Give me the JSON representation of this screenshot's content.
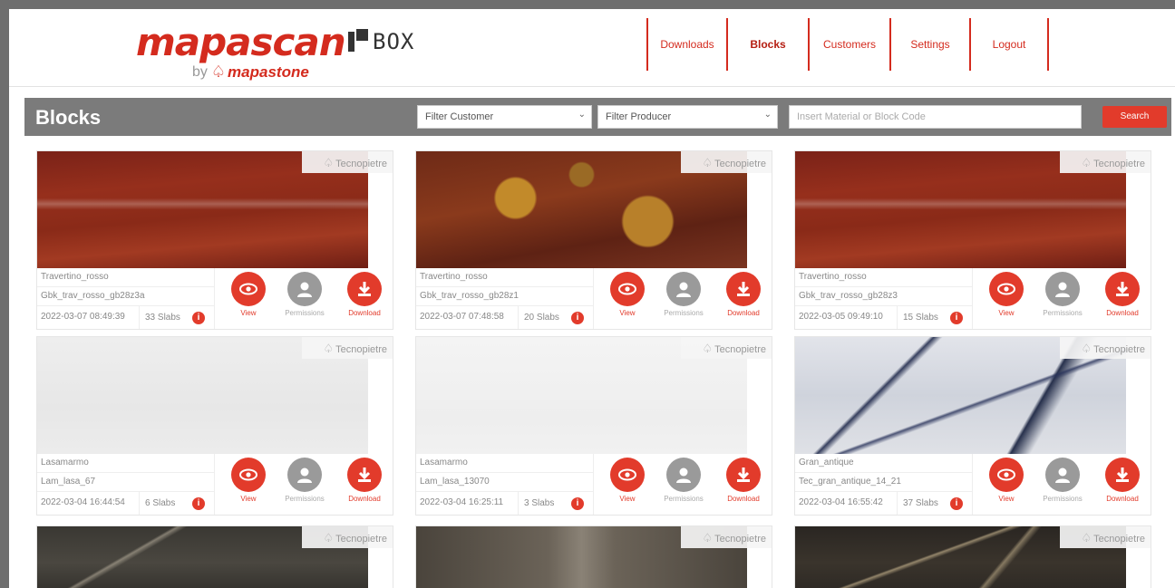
{
  "app": {
    "logo_main": "mapascan",
    "logo_box": "BOX",
    "logo_by": "by",
    "logo_brand": "mapastone"
  },
  "nav": {
    "items": [
      {
        "label": "Downloads"
      },
      {
        "label": "Blocks"
      },
      {
        "label": "Customers"
      },
      {
        "label": "Settings"
      },
      {
        "label": "Logout"
      }
    ]
  },
  "toolbar": {
    "title": "Blocks",
    "filter_customer": "Filter Customer",
    "filter_producer": "Filter Producer",
    "search_placeholder": "Insert Material or Block Code",
    "search_label": "Search"
  },
  "card_labels": {
    "brand": "Tecnopietre",
    "view": "View",
    "permissions": "Permissions",
    "download": "Download"
  },
  "blocks": [
    {
      "material": "Travertino_rosso",
      "code": "Gbk_trav_rosso_gb28z3a",
      "date": "2022-03-07 08:49:39",
      "slabs": "33 Slabs"
    },
    {
      "material": "Travertino_rosso",
      "code": "Gbk_trav_rosso_gb28z1",
      "date": "2022-03-07 07:48:58",
      "slabs": "20 Slabs"
    },
    {
      "material": "Travertino_rosso",
      "code": "Gbk_trav_rosso_gb28z3",
      "date": "2022-03-05 09:49:10",
      "slabs": "15 Slabs"
    },
    {
      "material": "Lasamarmo",
      "code": "Lam_lasa_67",
      "date": "2022-03-04 16:44:54",
      "slabs": "6 Slabs"
    },
    {
      "material": "Lasamarmo",
      "code": "Lam_lasa_13070",
      "date": "2022-03-04 16:25:11",
      "slabs": "3 Slabs"
    },
    {
      "material": "Gran_antique",
      "code": "Tec_gran_antique_14_21",
      "date": "2022-03-04 16:55:42",
      "slabs": "37 Slabs"
    }
  ]
}
